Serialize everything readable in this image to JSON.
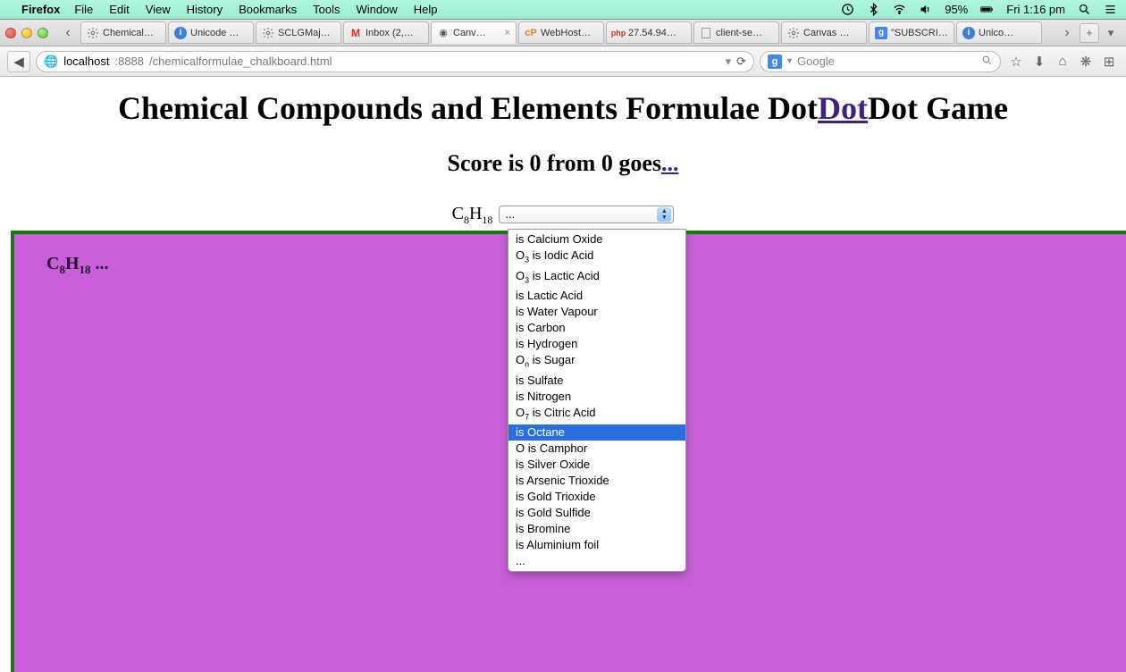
{
  "menubar": {
    "app": "Firefox",
    "items": [
      "File",
      "Edit",
      "View",
      "History",
      "Bookmarks",
      "Tools",
      "Window",
      "Help"
    ],
    "battery": "95%",
    "clock": "Fri 1:16 pm"
  },
  "tabs": {
    "list": [
      {
        "title": "Chemical…",
        "icon": "gear"
      },
      {
        "title": "Unicode …",
        "icon": "info"
      },
      {
        "title": "SCLGMaj…",
        "icon": "gear"
      },
      {
        "title": "Inbox (2,…",
        "icon": "gmail"
      },
      {
        "title": "Canv…",
        "icon": "globe",
        "active": true
      },
      {
        "title": "WebHost…",
        "icon": "cp"
      },
      {
        "title": "27.54.94…",
        "icon": "pma"
      },
      {
        "title": "client-se…",
        "icon": "page"
      },
      {
        "title": "Canvas …",
        "icon": "gear"
      },
      {
        "title": "\"SUBSCRI…",
        "icon": "g"
      },
      {
        "title": "Unico…",
        "icon": "info"
      }
    ]
  },
  "urlbar": {
    "host": "localhost",
    "port": ":8888",
    "path": "/chemicalformulae_chalkboard.html",
    "search_placeholder": "Google"
  },
  "page": {
    "title_pre": "Chemical Compounds and Elements Formulae Dot",
    "title_link": "Dot",
    "title_post": "Dot Game",
    "score_pre": "Score is ",
    "score_val": "0",
    "score_mid": " from ",
    "goes_val": "0",
    "score_post": " goes",
    "score_dots": "...",
    "formula": "C",
    "formula_sub1": "8",
    "formula2": "H",
    "formula_sub2": "18",
    "select_current": "...",
    "chalk_formula": "C",
    "chalk_sub1": "8",
    "chalk_formula2": "H",
    "chalk_sub2": "18",
    "chalk_dots": " ..."
  },
  "dropdown": {
    "options": [
      {
        "text": "is Calcium Oxide"
      },
      {
        "prefix": "O",
        "sub": "3",
        "text": " is Iodic Acid"
      },
      {
        "prefix": "O",
        "sub": "3",
        "text": " is Lactic Acid"
      },
      {
        "text": "is Lactic Acid"
      },
      {
        "text": "is Water Vapour"
      },
      {
        "text": "is Carbon"
      },
      {
        "text": "is Hydrogen"
      },
      {
        "prefix": "O",
        "sub": "n",
        "text": " is Sugar"
      },
      {
        "text": "is Sulfate"
      },
      {
        "text": "is Nitrogen"
      },
      {
        "prefix": "O",
        "sub": "7",
        "text": " is Citric Acid"
      },
      {
        "text": "is Octane",
        "highlight": true
      },
      {
        "prefix": "O",
        "text": " is Camphor"
      },
      {
        "text": "is Silver Oxide"
      },
      {
        "text": "is Arsenic Trioxide"
      },
      {
        "text": "is Gold Trioxide"
      },
      {
        "text": "is Gold Sulfide"
      },
      {
        "text": "is Bromine"
      },
      {
        "text": "is Aluminium foil"
      },
      {
        "text": "..."
      }
    ]
  }
}
